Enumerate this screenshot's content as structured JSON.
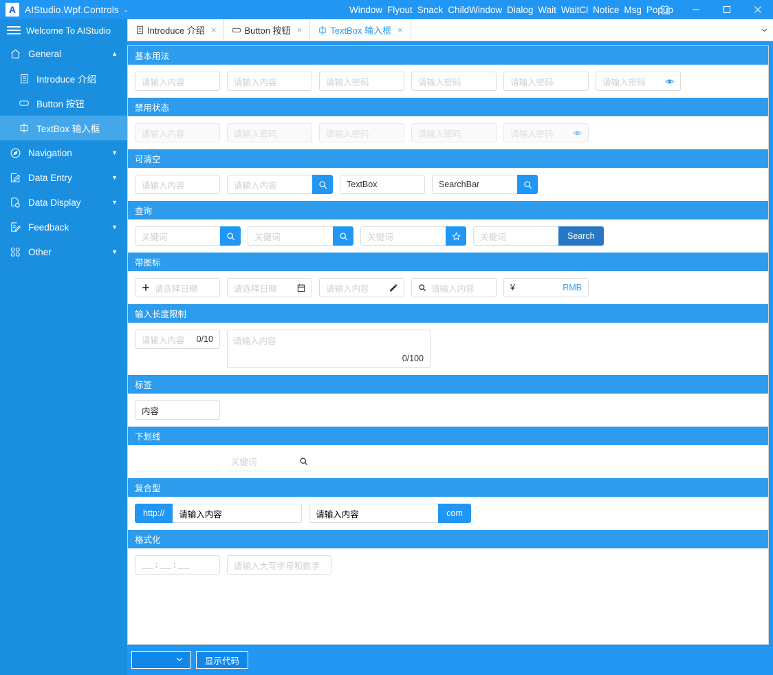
{
  "titlebar": {
    "app_name": "AIStudio.Wpf.Controls",
    "app_logo_letter": "A",
    "caret": "⌄",
    "menu": [
      "Window",
      "Flyout",
      "Snack",
      "ChildWindow",
      "Dialog",
      "Wait",
      "WaitCl",
      "Notice",
      "Msg",
      "Popup"
    ],
    "skin_icon": "tshirt-icon",
    "minimize_icon": "minimize-icon",
    "maximize_icon": "maximize-icon",
    "close_icon": "close-icon"
  },
  "sidebar": {
    "header": "Welcome To AIStudio",
    "groups": [
      {
        "label": "General",
        "icon": "home-icon",
        "caret": "▲",
        "expanded": true,
        "items": [
          {
            "label": "Introduce 介绍",
            "icon": "document-icon",
            "active": false
          },
          {
            "label": "Button 按钮",
            "icon": "button-icon",
            "active": false
          },
          {
            "label": "TextBox 输入框",
            "icon": "textbox-icon",
            "active": true
          }
        ]
      },
      {
        "label": "Navigation",
        "icon": "compass-icon",
        "caret": "▼",
        "expanded": false,
        "items": []
      },
      {
        "label": "Data Entry",
        "icon": "edit-box-icon",
        "caret": "▼",
        "expanded": false,
        "items": []
      },
      {
        "label": "Data Display",
        "icon": "page-search-icon",
        "caret": "▼",
        "expanded": false,
        "items": []
      },
      {
        "label": "Feedback",
        "icon": "form-edit-icon",
        "caret": "▼",
        "expanded": false,
        "items": []
      },
      {
        "label": "Other",
        "icon": "grid-icon",
        "caret": "▼",
        "expanded": false,
        "items": []
      }
    ]
  },
  "tabs": [
    {
      "label": "Introduce 介绍",
      "icon": "document-icon",
      "active": false,
      "close": "×"
    },
    {
      "label": "Button 按钮",
      "icon": "button-icon",
      "active": false,
      "close": "×"
    },
    {
      "label": "TextBox 输入框",
      "icon": "textbox-icon",
      "active": true,
      "close": "×"
    }
  ],
  "tabstrip_overflow_icon": "chevron-down-icon",
  "sections": {
    "basic": {
      "title": "基本用法",
      "f1": "请输入内容",
      "f2": "请输入内容",
      "f3": "请输入密码",
      "f4": "请输入密码",
      "f5": "请输入密码",
      "f6": "请输入密码"
    },
    "disabled": {
      "title": "禁用状态",
      "f1": "请输入内容",
      "f2": "请输入密码",
      "f3": "请输入密码",
      "f4": "请输入密码",
      "f5": "请输入密码"
    },
    "clearable": {
      "title": "可清空",
      "f1": "请输入内容",
      "f2": "请输入内容",
      "f3_value": "TextBox",
      "f4_value": "SearchBar"
    },
    "query": {
      "title": "查询",
      "f1": "关键词",
      "f2": "关键词",
      "f3": "关键词",
      "f4": "关键词",
      "search_button": "Search"
    },
    "with_icon": {
      "title": "带图标",
      "f1": "请选择日期",
      "f2": "请选择日期",
      "f3": "请输入内容",
      "f4": "请输入内容",
      "currency_symbol": "¥",
      "currency_label": "RMB"
    },
    "length_limit": {
      "title": "输入长度限制",
      "f1": "请输入内容",
      "f1_count": "0/10",
      "f2": "请输入内容",
      "f2_count": "0/100"
    },
    "tag": {
      "title": "标签",
      "f1_value": "内容"
    },
    "underline": {
      "title": "下划线",
      "f1": "",
      "f2": "关键词"
    },
    "composite": {
      "title": "复合型",
      "prefix": "http://",
      "f1": "请输入内容",
      "f2": "请输入内容",
      "suffix": "com"
    },
    "format": {
      "title": "格式化",
      "mask": "__:__:__",
      "f2": "请输入大写字母和数字"
    }
  },
  "bottombar": {
    "select_value": "",
    "select_caret": "⌄",
    "show_code_button": "显示代码"
  },
  "colors": {
    "accent": "#2196f3",
    "section_head": "#2d9cec",
    "sidebar": "#1a8fe0",
    "sidebar_active": "#43a7ea",
    "search_button": "#2778c4"
  }
}
